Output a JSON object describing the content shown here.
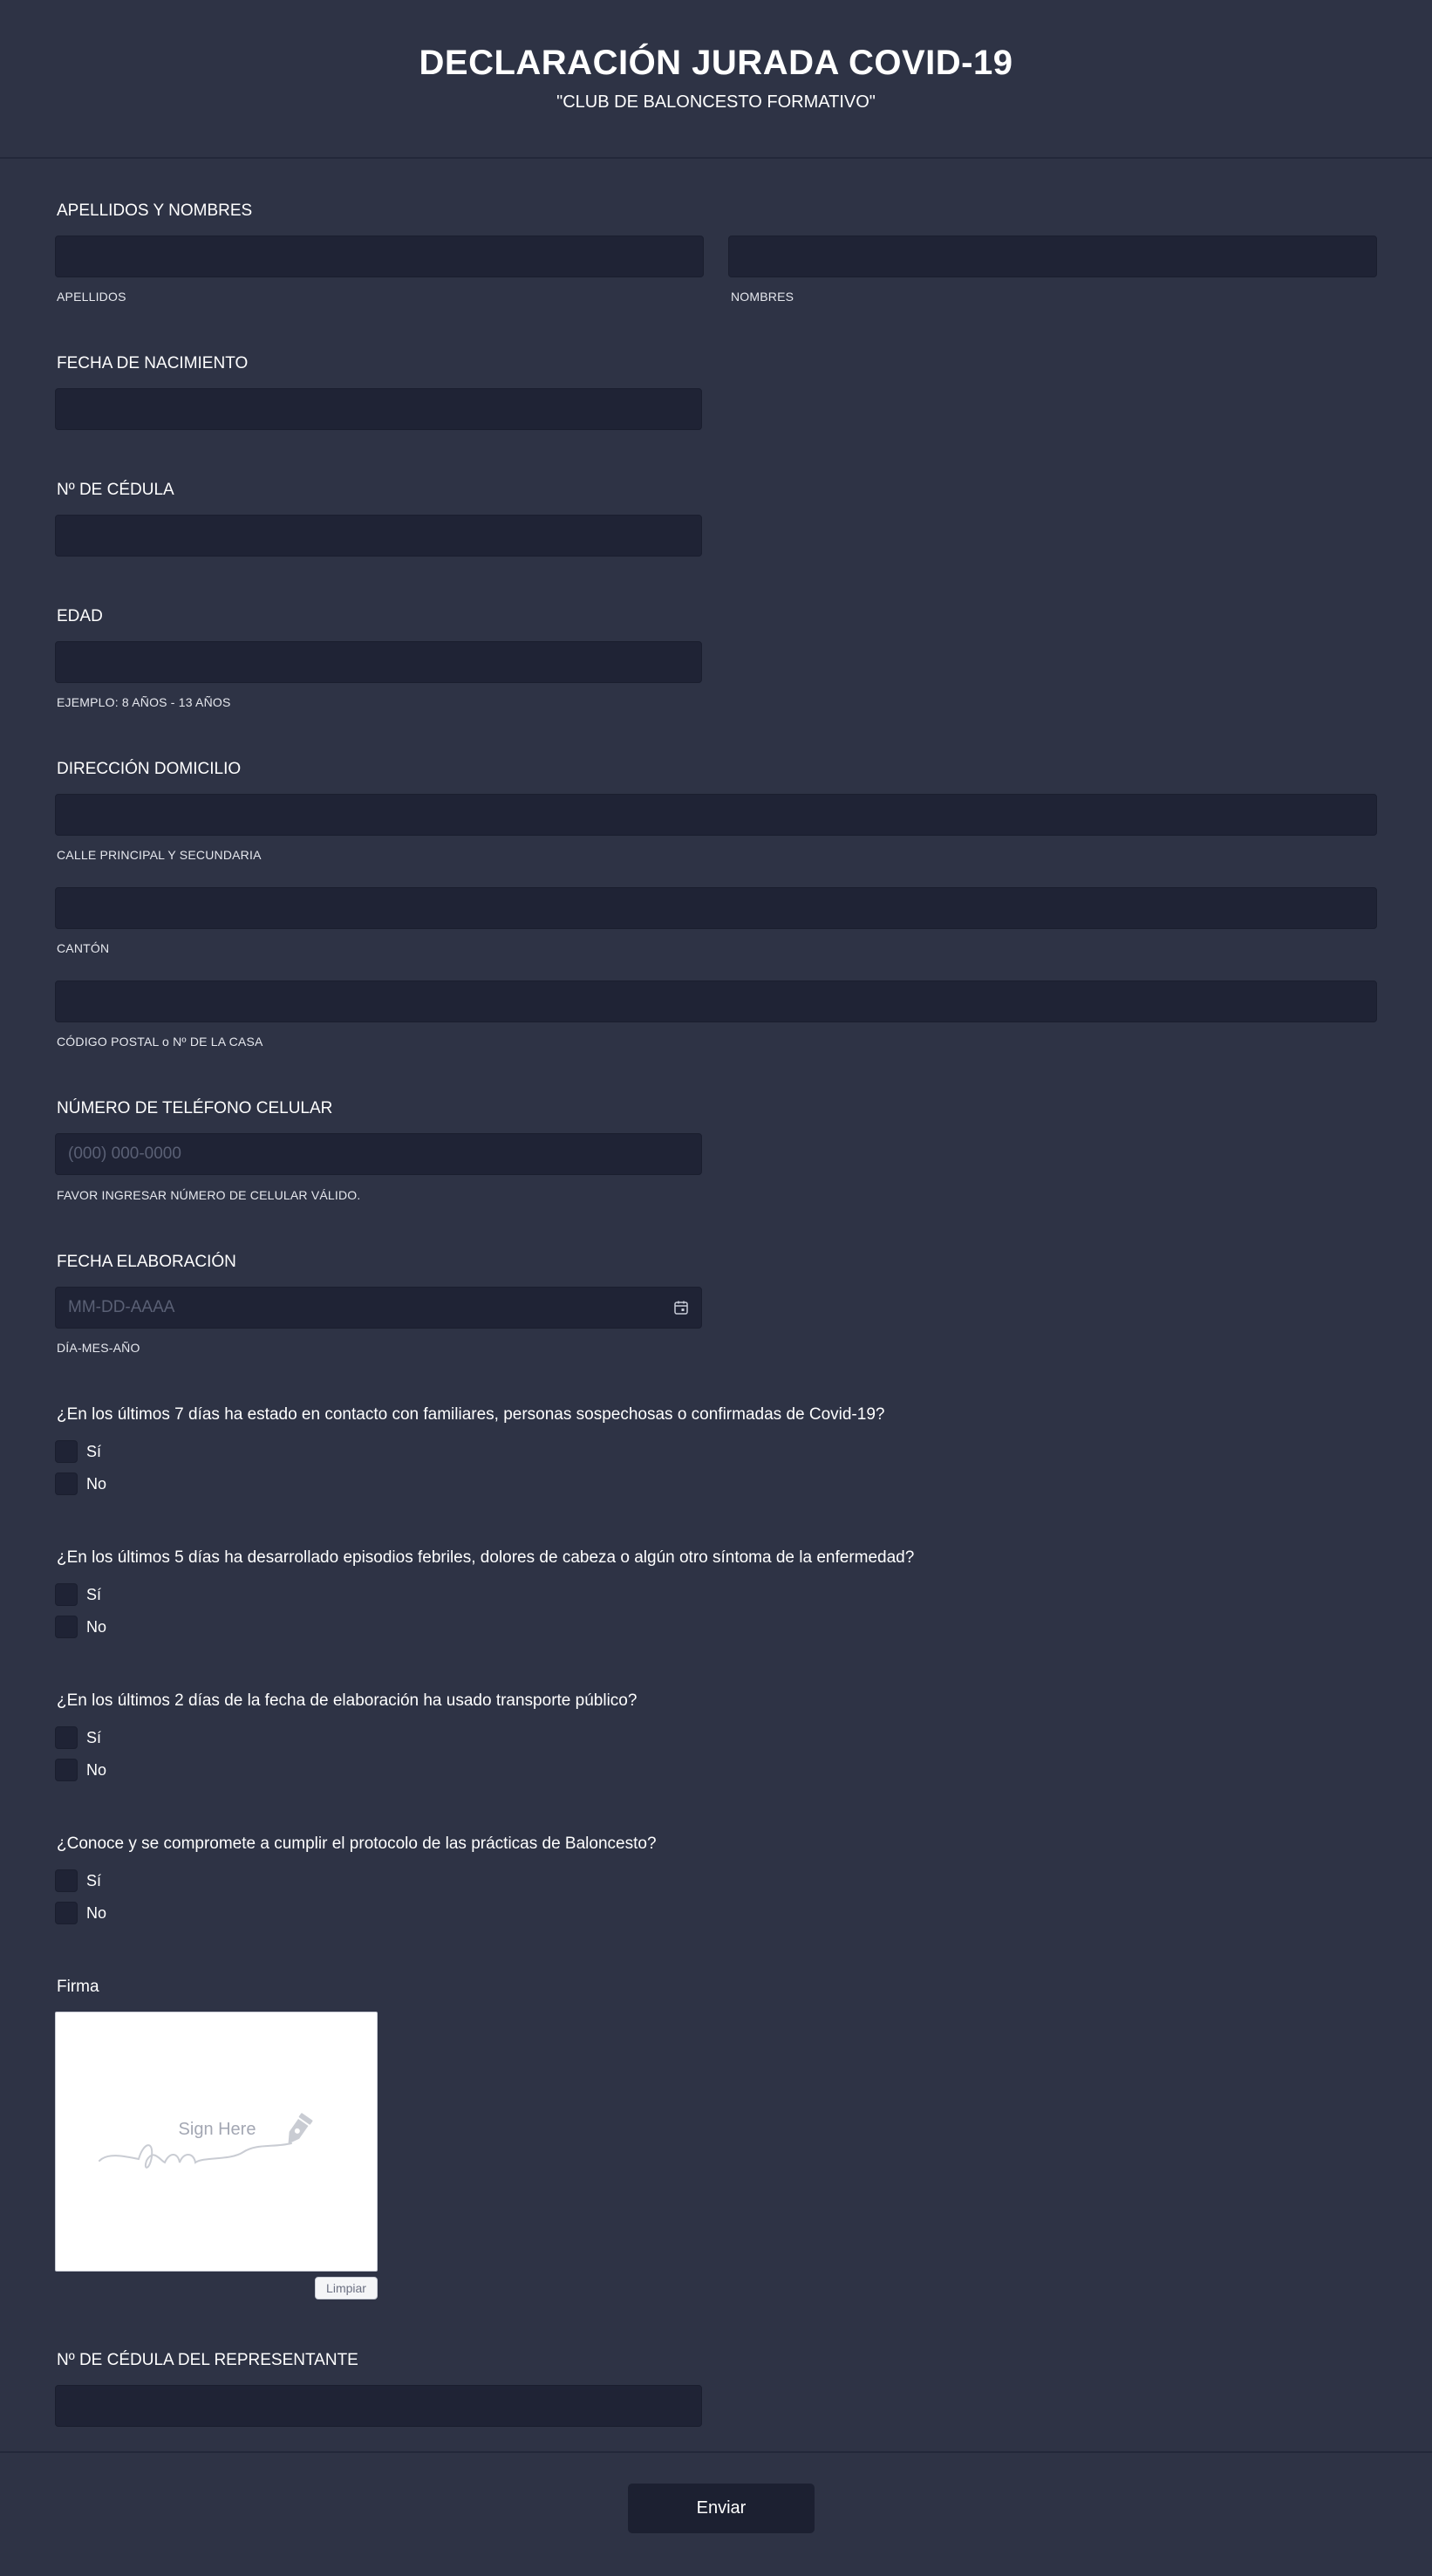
{
  "header": {
    "title": "DECLARACIÓN JURADA COVID-19",
    "subtitle": "\"CLUB DE BALONCESTO FORMATIVO\""
  },
  "fields": {
    "name": {
      "label": "APELLIDOS Y NOMBRES",
      "sub_last": "APELLIDOS",
      "sub_first": "NOMBRES",
      "value_last": "",
      "value_first": ""
    },
    "birthdate": {
      "label": "FECHA DE NACIMIENTO",
      "value": ""
    },
    "id_number": {
      "label": "Nº DE CÉDULA",
      "value": ""
    },
    "age": {
      "label": "EDAD",
      "sub": "EJEMPLO: 8 AÑOS - 13 AÑOS",
      "value": ""
    },
    "address": {
      "label": "DIRECCIÓN DOMICILIO",
      "sub_street": "CALLE PRINCIPAL Y SECUNDARIA",
      "sub_canton": "CANTÓN",
      "sub_postal": "CÓDIGO POSTAL o Nº DE LA CASA"
    },
    "phone": {
      "label": "NÚMERO DE TELÉFONO CELULAR",
      "placeholder": "(000) 000-0000",
      "sub": "FAVOR INGRESAR NÚMERO DE CELULAR VÁLIDO."
    },
    "date": {
      "label": "FECHA ELABORACIÓN",
      "placeholder": "MM-DD-AAAA",
      "sub": "DÍA-MES-AÑO"
    },
    "rep_id": {
      "label": "Nº DE CÉDULA DEL REPRESENTANTE",
      "value": ""
    }
  },
  "questions": [
    {
      "text": "¿En los últimos 7 días ha estado en contacto con familiares, personas sospechosas o confirmadas de Covid-19?",
      "options": [
        "Sí",
        "No"
      ]
    },
    {
      "text": "¿En los últimos 5 días ha desarrollado episodios febriles, dolores de cabeza o algún otro síntoma de la enfermedad?",
      "options": [
        "Sí",
        "No"
      ]
    },
    {
      "text": "¿En los últimos 2 días de la fecha de elaboración ha usado transporte público?",
      "options": [
        "Sí",
        "No"
      ]
    },
    {
      "text": "¿Conoce y se compromete a cumplir el protocolo de las prácticas de Baloncesto?",
      "options": [
        "Sí",
        "No"
      ]
    }
  ],
  "signature": {
    "label": "Firma",
    "hint": "Sign Here",
    "clear_label": "Limpiar"
  },
  "submit": {
    "label": "Enviar"
  },
  "colors": {
    "background": "#2e3345",
    "input": "#1f2335",
    "button": "#1c2031"
  }
}
